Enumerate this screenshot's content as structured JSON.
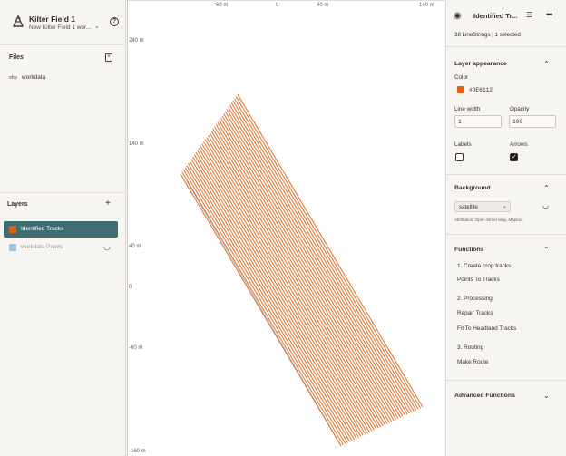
{
  "app": {
    "title": "Kilter Field 1",
    "subtitle": "New Kilter Field 1 wor..."
  },
  "files": {
    "title": "Files",
    "items": [
      {
        "icon": "shp",
        "name": "workdata"
      }
    ]
  },
  "layers": {
    "title": "Layers",
    "items": [
      {
        "name": "Identified Tracks",
        "color": "#DE6112",
        "active": true
      },
      {
        "name": "workdata Points",
        "color": "#9EC2DD",
        "active": false
      }
    ]
  },
  "map": {
    "x_ticks": [
      "-60 m",
      "0",
      "40 m",
      "140 m"
    ],
    "y_ticks": [
      "240 m",
      "140 m",
      "40 m",
      "0",
      "-60 m",
      "-160 m"
    ],
    "track_color": "#DE6112",
    "points_color": "#9EC2DD",
    "track_count": 38
  },
  "panel": {
    "title": "Identified Tr...",
    "summary": "38 LineStrings | 1 selected",
    "appearance": {
      "title": "Layer appearance",
      "color_label": "Color",
      "color_value": "#DE6112",
      "line_width_label": "Line width",
      "line_width_value": "1",
      "opacity_label": "Opacity",
      "opacity_value": "100",
      "labels_label": "Labels",
      "labels_checked": false,
      "arrows_label": "Arrows",
      "arrows_checked": true
    },
    "background": {
      "title": "Background",
      "selected": "satellite",
      "attribution": "Attribution: Open Street Map, Mapbox"
    },
    "functions": {
      "title": "Functions",
      "groups": [
        {
          "heading": "1. Create crop tracks",
          "items": [
            "Points To Tracks"
          ]
        },
        {
          "heading": "2. Processing",
          "items": [
            "Repair Tracks",
            "Fit To Headland Tracks"
          ]
        },
        {
          "heading": "3. Routing",
          "items": [
            "Make Route"
          ]
        }
      ]
    },
    "advanced": {
      "title": "Advanced Functions"
    }
  }
}
